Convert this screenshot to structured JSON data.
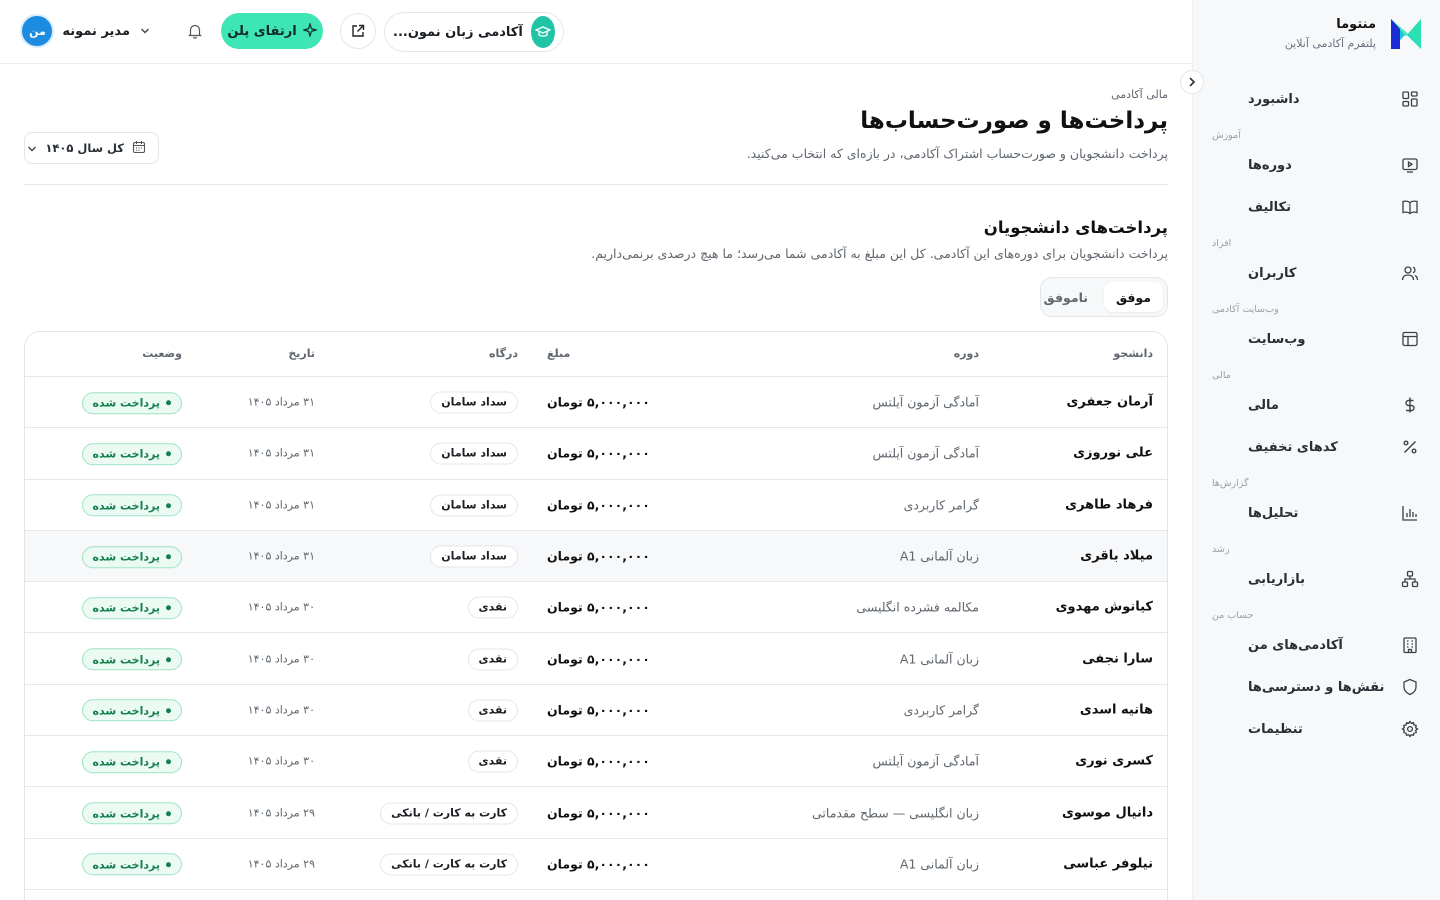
{
  "app": {
    "brand_name": "منتوما",
    "brand_tagline": "پلتفرم آکادمی آنلاین"
  },
  "sidebar": {
    "items": [
      {
        "group": "",
        "label": "داشبورد",
        "icon": "dashboard-icon"
      },
      {
        "group": "آموزش",
        "label": "دوره‌ها",
        "icon": "video-icon"
      },
      {
        "group": "",
        "label": "تکالیف",
        "icon": "book-icon"
      },
      {
        "group": "افراد",
        "label": "کاربران",
        "icon": "users-icon"
      },
      {
        "group": "وب‌سایت آکادمی",
        "label": "وب‌سایت",
        "icon": "layout-icon"
      },
      {
        "group": "مالی",
        "label": "مالی",
        "icon": "dollar-icon"
      },
      {
        "group": "",
        "label": "کدهای تخفیف",
        "icon": "percent-icon"
      },
      {
        "group": "گزارش‌ها",
        "label": "تحلیل‌ها",
        "icon": "chart-icon"
      },
      {
        "group": "رشد",
        "label": "بازاریابی",
        "icon": "network-icon"
      },
      {
        "group": "حساب من",
        "label": "آکادمی‌های من",
        "icon": "building-icon"
      },
      {
        "group": "",
        "label": "نقش‌ها و دسترسی‌ها",
        "icon": "shield-icon"
      },
      {
        "group": "",
        "label": "تنظیمات",
        "icon": "gear-icon"
      }
    ]
  },
  "topbar": {
    "academy_name": "آکادمی زبان نمون...",
    "upgrade_label": "ارتقای پلن",
    "user_initials": "من",
    "user_name": "مدیر نمونه"
  },
  "page": {
    "breadcrumb": "مالی آکادمی",
    "title": "پرداخت‌ها و صورت‌حساب‌ها",
    "subtitle": "پرداخت دانشجویان و صورت‌حساب اشتراک آکادمی، در بازه‌ای که انتخاب می‌کنید.",
    "year_filter": "کل سال ۱۴۰۵"
  },
  "section": {
    "title": "پرداخت‌های دانشجویان",
    "subtitle": "پرداخت دانشجویان برای دوره‌های این آکادمی. کل این مبلغ به آکادمی شما می‌رسد؛ ما هیچ درصدی برنمی‌داریم.",
    "tabs": [
      "موفق",
      "ناموفق"
    ],
    "active_tab": "موفق"
  },
  "table": {
    "columns": [
      "دانشجو",
      "دوره",
      "مبلغ",
      "درگاه",
      "تاریخ",
      "وضعیت"
    ],
    "rows": [
      {
        "student": "آرمان جعفری",
        "course": "آمادگی آزمون آیلتس",
        "amount": "۵,۰۰۰,۰۰۰ تومان",
        "gateway": "سداد سامان",
        "date": "۳۱ مرداد ۱۴۰۵",
        "status": "پرداخت شده"
      },
      {
        "student": "علی نوروزی",
        "course": "آمادگی آزمون آیلتس",
        "amount": "۵,۰۰۰,۰۰۰ تومان",
        "gateway": "سداد سامان",
        "date": "۳۱ مرداد ۱۴۰۵",
        "status": "پرداخت شده"
      },
      {
        "student": "فرهاد طاهری",
        "course": "گرامر کاربردی",
        "amount": "۵,۰۰۰,۰۰۰ تومان",
        "gateway": "سداد سامان",
        "date": "۳۱ مرداد ۱۴۰۵",
        "status": "پرداخت شده"
      },
      {
        "student": "میلاد باقری",
        "course": "زبان آلمانی A1",
        "amount": "۵,۰۰۰,۰۰۰ تومان",
        "gateway": "سداد سامان",
        "date": "۳۱ مرداد ۱۴۰۵",
        "status": "پرداخت شده"
      },
      {
        "student": "کیانوش مهدوی",
        "course": "مکالمه فشرده انگلیسی",
        "amount": "۵,۰۰۰,۰۰۰ تومان",
        "gateway": "نقدی",
        "date": "۳۰ مرداد ۱۴۰۵",
        "status": "پرداخت شده"
      },
      {
        "student": "سارا نجفی",
        "course": "زبان آلمانی A1",
        "amount": "۵,۰۰۰,۰۰۰ تومان",
        "gateway": "نقدی",
        "date": "۳۰ مرداد ۱۴۰۵",
        "status": "پرداخت شده"
      },
      {
        "student": "هانیه اسدی",
        "course": "گرامر کاربردی",
        "amount": "۵,۰۰۰,۰۰۰ تومان",
        "gateway": "نقدی",
        "date": "۳۰ مرداد ۱۴۰۵",
        "status": "پرداخت شده"
      },
      {
        "student": "کسری نوری",
        "course": "آمادگی آزمون آیلتس",
        "amount": "۵,۰۰۰,۰۰۰ تومان",
        "gateway": "نقدی",
        "date": "۳۰ مرداد ۱۴۰۵",
        "status": "پرداخت شده"
      },
      {
        "student": "دانیال موسوی",
        "course": "زبان انگلیسی — سطح مقدماتی",
        "amount": "۵,۰۰۰,۰۰۰ تومان",
        "gateway": "کارت به کارت / بانکی",
        "date": "۲۹ مرداد ۱۴۰۵",
        "status": "پرداخت شده"
      },
      {
        "student": "نیلوفر عباسی",
        "course": "زبان آلمانی A1",
        "amount": "۵,۰۰۰,۰۰۰ تومان",
        "gateway": "کارت به کارت / بانکی",
        "date": "۲۹ مرداد ۱۴۰۵",
        "status": "پرداخت شده"
      }
    ]
  },
  "colors": {
    "accent": "#3ee6b5",
    "brand_teal": "#22c4a7",
    "avatar_blue": "#1c8be0",
    "status_green": "#15804f"
  }
}
